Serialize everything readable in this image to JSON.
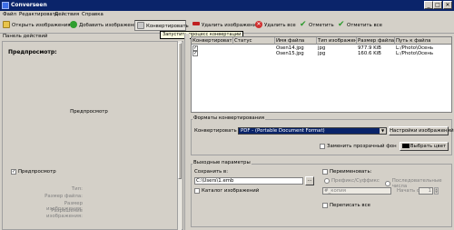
{
  "window": {
    "title": "Converseen",
    "controls": [
      "_",
      "□",
      "✕"
    ]
  },
  "menu": [
    "Файл",
    "Редактировать",
    "Действия",
    "Справка"
  ],
  "toolbar": {
    "open": "Открыть изображения",
    "add": "Добавить изображения",
    "convert": "Конвертировать",
    "remove": "Удалить изображения",
    "remove_all": "Удалить все",
    "check": "Отметить",
    "check_all": "Отметить все",
    "tooltip": "Запустить процесс конвертации",
    "colors": {
      "add": "#2f9e2f",
      "remove": "#c02020",
      "remove_all": "#d03030",
      "check": "#2e9a2e"
    }
  },
  "left_panel": {
    "title": "Панель действий",
    "preview_heading": "Предпросмотр:",
    "preview_placeholder": "Предпросмотр",
    "preview_checkbox": "Предпросмотр",
    "info_labels": [
      "Тип:",
      "Размер файла:",
      "Размер изображения:",
      "Разрешение изображения:"
    ]
  },
  "table": {
    "columns": [
      "Конвертировать",
      "Статус",
      "Имя файла",
      "Тип изображения",
      "Размер файла",
      "Путь к файла"
    ],
    "rows": [
      {
        "checked": true,
        "status": "",
        "name": "Osen14.jpg",
        "type": "jpg",
        "size": "977.9 KiB",
        "path": "L:/Photo\\Осень"
      },
      {
        "checked": true,
        "status": "",
        "name": "Osen15.jpg",
        "type": "jpg",
        "size": "160.6 KiB",
        "path": "L:/Photo\\Осень"
      }
    ]
  },
  "formats": {
    "group_title": "Форматы конвертирования",
    "label": "Конвертировать в:",
    "selected": "PDF - (Portable Document Format)",
    "settings_button": "Настройки изображений",
    "transparent_label": "Заменить прозрачный фон",
    "color_button": "Выбрать цвет",
    "color_swatch": "#000000"
  },
  "output": {
    "group_title": "Выходные параметры",
    "save_label": "Сохранить в:",
    "path_value": "C:\\Users\\1.emb",
    "browse": "...",
    "catalog_label": "Каталог изображений",
    "rename_label": "Переименовать:",
    "prefix_label": "Префикс/Суффикс",
    "sequential_label": "Последовательные числа",
    "pattern_value": "#_копия",
    "start_label": "Начать с:",
    "start_value": "1",
    "overwrite_label": "Переписать все"
  }
}
